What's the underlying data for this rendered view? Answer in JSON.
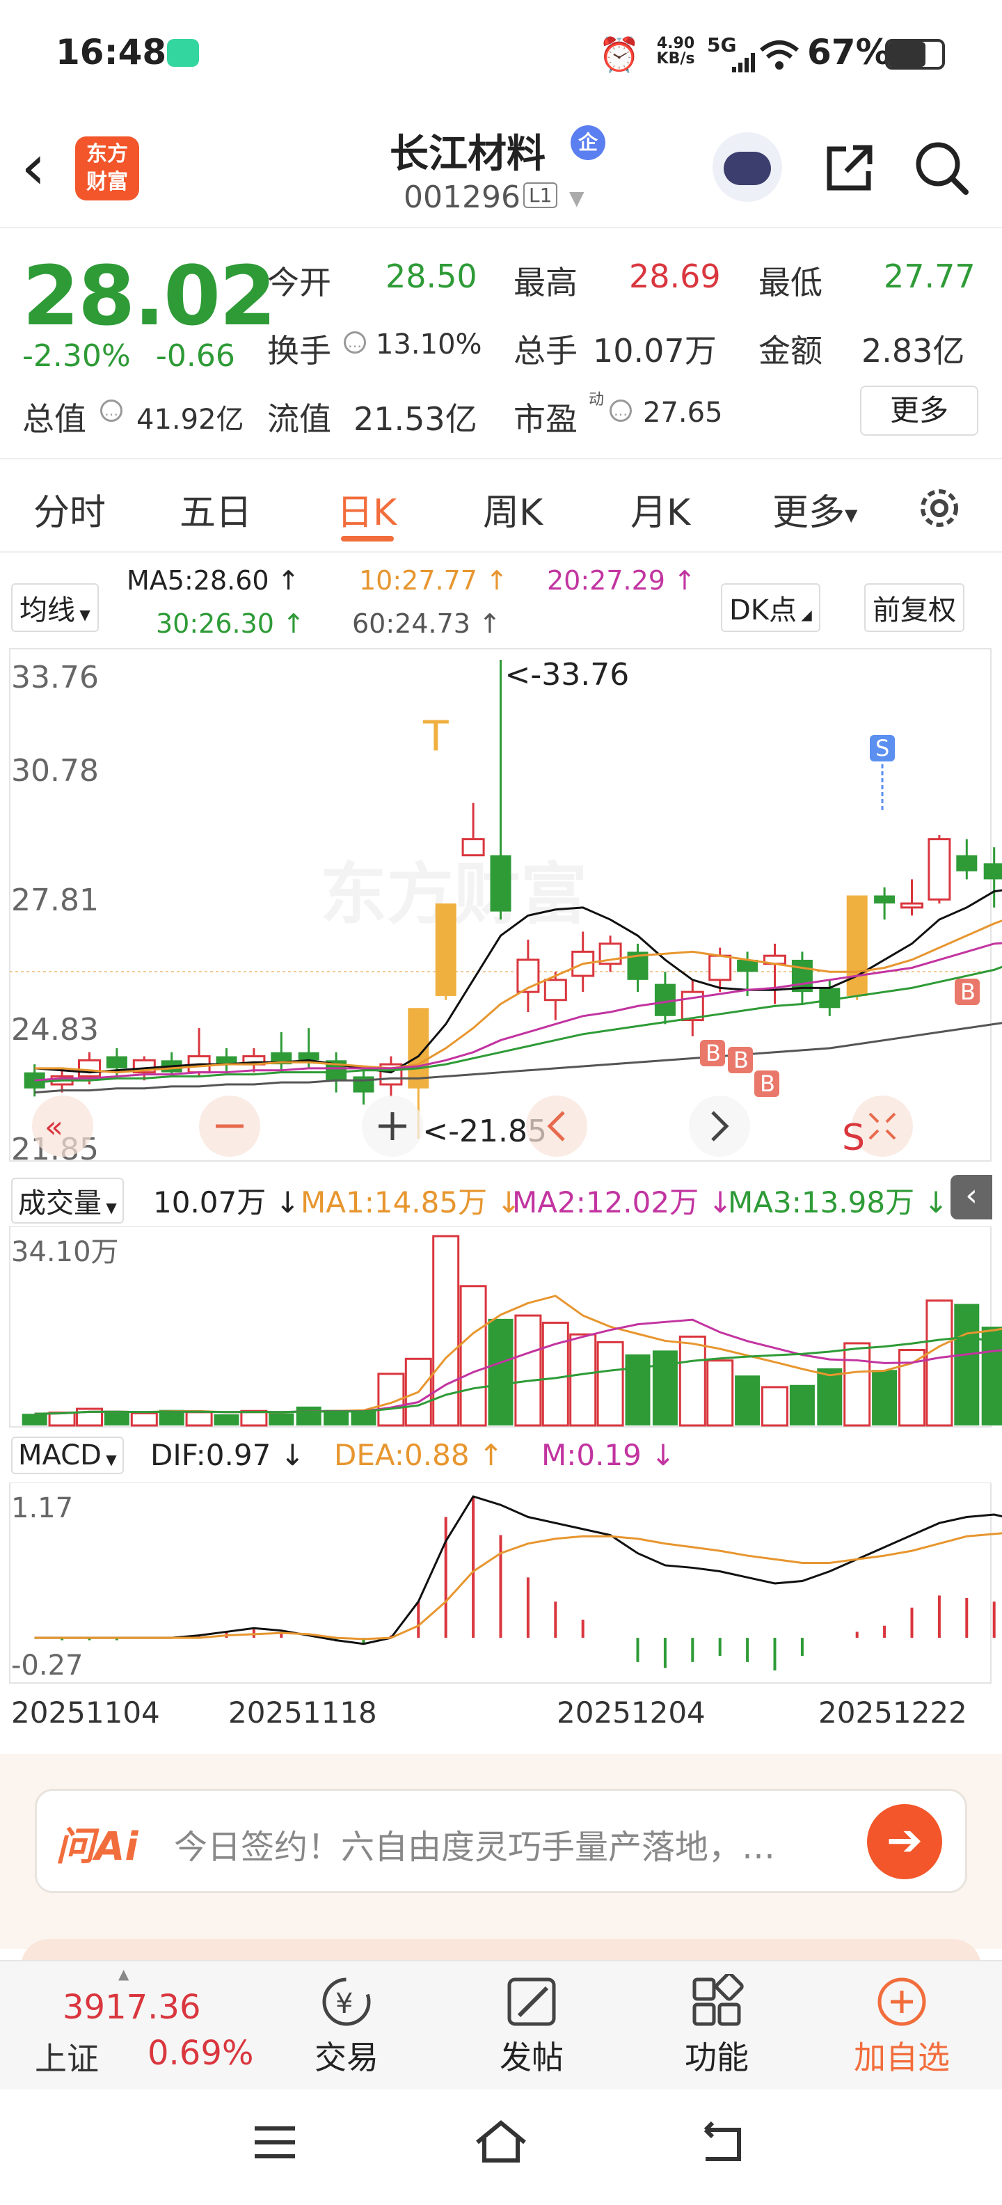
{
  "status": {
    "time": "16:48",
    "net_speed_value": "4.90",
    "net_speed_unit": "KB/s",
    "network": "5G",
    "battery": "67%"
  },
  "header": {
    "stock_name": "长江材料",
    "badge": "企",
    "code": "001296",
    "level": "L1",
    "logo_line1": "东方",
    "logo_line2": "财富"
  },
  "quote": {
    "price": "28.02",
    "change_pct": "-2.30%",
    "change": "-0.66",
    "open_label": "今开",
    "open": "28.50",
    "high_label": "最高",
    "high": "28.69",
    "low_label": "最低",
    "low": "27.77",
    "turnover_label": "换手",
    "turnover": "13.10%",
    "volume_label": "总手",
    "volume": "10.07万",
    "amount_label": "金额",
    "amount": "2.83亿",
    "mktcap_label": "总值",
    "mktcap": "41.92亿",
    "float_label": "流值",
    "float_cap": "21.53亿",
    "pe_label": "市盈",
    "pe_sup": "动",
    "pe": "27.65",
    "more": "更多"
  },
  "tabs": [
    "分时",
    "五日",
    "日K",
    "周K",
    "月K",
    "更多"
  ],
  "ma_row": {
    "selector": "均线",
    "ma5": "MA5:28.60 ↑",
    "ma10": "10:27.77 ↑",
    "ma20": "20:27.29 ↑",
    "ma30": "30:26.30 ↑",
    "ma60": "60:24.73 ↑",
    "dk_button": "DK点",
    "adjust_button": "前复权"
  },
  "kline": {
    "y_ticks": [
      "33.76",
      "30.78",
      "27.81",
      "24.83",
      "21.85"
    ],
    "max_label": "<-33.76",
    "min_label": "<-21.85",
    "watermark": "东方财富",
    "signal_s": "S",
    "signal_b": "B",
    "nav_s_label": "S"
  },
  "volume": {
    "selector": "成交量",
    "vol": "10.07万 ↓",
    "ma1": "MA1:14.85万 ↓",
    "ma2": "MA2:12.02万 ↓",
    "ma3": "MA3:13.98万 ↓",
    "y_max": "34.10万"
  },
  "macd": {
    "selector": "MACD",
    "dif": "DIF:0.97 ↓",
    "dea": "DEA:0.88 ↑",
    "m": "M:0.19 ↓",
    "y_max": "1.17",
    "y_min": "-0.27"
  },
  "dates": [
    "20251104",
    "20251118",
    "20251204",
    "20251222"
  ],
  "ai": {
    "logo": "问Ai",
    "text": "今日签约！六自由度灵巧手量产落地，…"
  },
  "bottom_nav": {
    "index_value": "3917.36",
    "index_name": "上证",
    "index_pct": "0.69%",
    "items": [
      "交易",
      "发帖",
      "功能",
      "加自选"
    ]
  },
  "colors": {
    "up": "#d9363e",
    "down": "#2e9b37",
    "accent": "#f26d3c",
    "ma5": "#111111",
    "ma10": "#e7962f",
    "ma20": "#c234a0",
    "ma30": "#2e9b37",
    "ma60": "#555555"
  },
  "chart_data": {
    "type": "candlestick",
    "y_axis_range": [
      21.85,
      33.76
    ],
    "x_labels": [
      "20251104",
      "20251118",
      "20251204",
      "20251222"
    ],
    "candles": [
      {
        "o": 23.5,
        "c": 23.1,
        "h": 23.7,
        "l": 22.9
      },
      {
        "o": 23.2,
        "c": 23.4,
        "h": 23.6,
        "l": 23.0
      },
      {
        "o": 23.4,
        "c": 23.8,
        "h": 24.0,
        "l": 23.2
      },
      {
        "o": 23.9,
        "c": 23.6,
        "h": 24.1,
        "l": 23.4
      },
      {
        "o": 23.5,
        "c": 23.8,
        "h": 23.9,
        "l": 23.3
      },
      {
        "o": 23.8,
        "c": 23.5,
        "h": 24.0,
        "l": 23.4
      },
      {
        "o": 23.5,
        "c": 23.9,
        "h": 24.6,
        "l": 23.4
      },
      {
        "o": 23.9,
        "c": 23.7,
        "h": 24.1,
        "l": 23.5
      },
      {
        "o": 23.7,
        "c": 23.9,
        "h": 24.1,
        "l": 23.5
      },
      {
        "o": 24.0,
        "c": 23.7,
        "h": 24.5,
        "l": 23.5
      },
      {
        "o": 24.0,
        "c": 23.8,
        "h": 24.6,
        "l": 23.6
      },
      {
        "o": 23.8,
        "c": 23.3,
        "h": 24.0,
        "l": 23.0
      },
      {
        "o": 23.4,
        "c": 23.0,
        "h": 23.6,
        "l": 22.7
      },
      {
        "o": 23.2,
        "c": 23.7,
        "h": 23.9,
        "l": 22.9
      },
      {
        "o": 23.1,
        "c": 25.1,
        "h": 25.1,
        "l": 21.85
      },
      {
        "o": 25.4,
        "c": 27.7,
        "h": 27.7,
        "l": 25.3
      },
      {
        "o": 28.9,
        "c": 29.3,
        "h": 30.2,
        "l": 28.9
      },
      {
        "o": 28.9,
        "c": 27.5,
        "h": 33.76,
        "l": 27.3
      },
      {
        "o": 25.5,
        "c": 26.3,
        "h": 26.8,
        "l": 25.0
      },
      {
        "o": 25.3,
        "c": 25.8,
        "h": 26.0,
        "l": 24.8
      },
      {
        "o": 25.9,
        "c": 26.5,
        "h": 27.0,
        "l": 25.5
      },
      {
        "o": 26.2,
        "c": 26.7,
        "h": 26.9,
        "l": 26.0
      },
      {
        "o": 26.5,
        "c": 25.8,
        "h": 26.7,
        "l": 25.5
      },
      {
        "o": 25.7,
        "c": 24.9,
        "h": 26.0,
        "l": 24.7
      },
      {
        "o": 24.8,
        "c": 25.5,
        "h": 25.8,
        "l": 24.4
      },
      {
        "o": 25.8,
        "c": 26.4,
        "h": 26.6,
        "l": 25.5
      },
      {
        "o": 26.3,
        "c": 26.0,
        "h": 26.5,
        "l": 25.4
      },
      {
        "o": 26.2,
        "c": 26.4,
        "h": 26.7,
        "l": 25.2
      },
      {
        "o": 26.3,
        "c": 25.5,
        "h": 26.5,
        "l": 25.2
      },
      {
        "o": 25.6,
        "c": 25.1,
        "h": 25.8,
        "l": 24.9
      },
      {
        "o": 25.4,
        "c": 27.9,
        "h": 27.9,
        "l": 25.3
      },
      {
        "o": 27.9,
        "c": 27.7,
        "h": 28.1,
        "l": 27.3
      },
      {
        "o": 27.6,
        "c": 27.7,
        "h": 28.3,
        "l": 27.4
      },
      {
        "o": 27.8,
        "c": 29.3,
        "h": 29.4,
        "l": 27.7
      },
      {
        "o": 28.9,
        "c": 28.5,
        "h": 29.3,
        "l": 28.3
      },
      {
        "o": 28.7,
        "c": 28.3,
        "h": 29.1,
        "l": 27.6
      },
      {
        "o": 28.5,
        "c": 28.02,
        "h": 28.69,
        "l": 27.77
      }
    ],
    "series": [
      {
        "name": "MA5",
        "values": [
          23.6,
          23.55,
          23.5,
          23.55,
          23.6,
          23.65,
          23.7,
          23.7,
          23.75,
          23.75,
          23.8,
          23.7,
          23.6,
          23.5,
          23.9,
          24.7,
          25.8,
          26.9,
          27.4,
          27.55,
          27.6,
          27.3,
          26.9,
          26.3,
          25.8,
          25.6,
          25.55,
          25.55,
          25.6,
          25.6,
          25.9,
          26.3,
          26.7,
          27.3,
          27.6,
          28.0,
          28.1
        ]
      },
      {
        "name": "MA10",
        "values": [
          23.6,
          23.6,
          23.55,
          23.5,
          23.55,
          23.6,
          23.65,
          23.7,
          23.7,
          23.75,
          23.75,
          23.7,
          23.65,
          23.6,
          23.7,
          24.1,
          24.6,
          25.2,
          25.6,
          25.9,
          26.2,
          26.3,
          26.4,
          26.45,
          26.5,
          26.4,
          26.3,
          26.2,
          26.1,
          26.0,
          26.0,
          26.1,
          26.3,
          26.6,
          26.9,
          27.2,
          27.45
        ]
      },
      {
        "name": "MA20",
        "values": [
          23.3,
          23.35,
          23.35,
          23.4,
          23.45,
          23.45,
          23.5,
          23.5,
          23.55,
          23.55,
          23.6,
          23.6,
          23.6,
          23.6,
          23.65,
          23.8,
          24.0,
          24.3,
          24.5,
          24.7,
          24.9,
          25.0,
          25.15,
          25.25,
          25.35,
          25.45,
          25.55,
          25.6,
          25.7,
          25.8,
          25.9,
          26.0,
          26.1,
          26.3,
          26.5,
          26.7,
          26.75
        ]
      },
      {
        "name": "MA30",
        "values": [
          23.25,
          23.3,
          23.3,
          23.35,
          23.35,
          23.4,
          23.4,
          23.45,
          23.45,
          23.5,
          23.5,
          23.5,
          23.55,
          23.55,
          23.6,
          23.7,
          23.85,
          24.0,
          24.15,
          24.3,
          24.45,
          24.55,
          24.65,
          24.75,
          24.85,
          24.95,
          25.05,
          25.15,
          25.2,
          25.3,
          25.4,
          25.5,
          25.6,
          25.75,
          25.9,
          26.05,
          26.3
        ]
      },
      {
        "name": "MA60",
        "values": [
          23.0,
          23.05,
          23.05,
          23.1,
          23.1,
          23.15,
          23.15,
          23.2,
          23.2,
          23.25,
          23.25,
          23.3,
          23.3,
          23.35,
          23.35,
          23.4,
          23.45,
          23.5,
          23.55,
          23.6,
          23.65,
          23.7,
          23.75,
          23.8,
          23.85,
          23.9,
          23.95,
          24.0,
          24.05,
          24.1,
          24.2,
          24.3,
          24.4,
          24.5,
          24.6,
          24.7,
          24.8
        ]
      }
    ],
    "volume": [
      2.1,
      2.3,
      3.0,
      2.5,
      2.2,
      2.8,
      2.4,
      2.0,
      2.6,
      2.2,
      3.4,
      2.8,
      2.6,
      9.3,
      12.0,
      34.1,
      25.1,
      19.2,
      19.8,
      18.5,
      16.4,
      15.0,
      12.8,
      13.5,
      16.0,
      11.7,
      9.0,
      6.9,
      7.3,
      10.3,
      14.8,
      10.0,
      13.6,
      22.5,
      21.9,
      17.8,
      14.0,
      10.07
    ],
    "macd_dif": [
      0.0,
      0.0,
      0.0,
      0.0,
      0.0,
      0.0,
      0.02,
      0.05,
      0.08,
      0.06,
      0.02,
      -0.02,
      -0.05,
      0.0,
      0.3,
      0.8,
      1.17,
      1.1,
      1.0,
      0.95,
      0.9,
      0.85,
      0.7,
      0.6,
      0.58,
      0.55,
      0.5,
      0.45,
      0.47,
      0.55,
      0.65,
      0.75,
      0.85,
      0.95,
      1.0,
      1.02,
      0.97
    ],
    "macd_dea": [
      0.0,
      0.0,
      0.0,
      0.0,
      0.0,
      0.0,
      0.0,
      0.02,
      0.03,
      0.04,
      0.03,
      0.0,
      -0.01,
      0.0,
      0.1,
      0.3,
      0.55,
      0.7,
      0.78,
      0.82,
      0.84,
      0.84,
      0.82,
      0.78,
      0.75,
      0.72,
      0.68,
      0.65,
      0.62,
      0.62,
      0.65,
      0.68,
      0.72,
      0.78,
      0.84,
      0.86,
      0.88
    ],
    "macd_m": [
      0.0,
      -0.02,
      -0.02,
      -0.02,
      0.0,
      0.0,
      0.02,
      0.05,
      0.07,
      0.05,
      0.0,
      -0.03,
      -0.05,
      0.02,
      0.3,
      1.0,
      1.17,
      0.85,
      0.5,
      0.3,
      0.15,
      0.0,
      -0.2,
      -0.25,
      -0.2,
      -0.15,
      -0.2,
      -0.27,
      -0.15,
      0.0,
      0.05,
      0.1,
      0.25,
      0.35,
      0.33,
      0.3,
      0.19
    ]
  }
}
